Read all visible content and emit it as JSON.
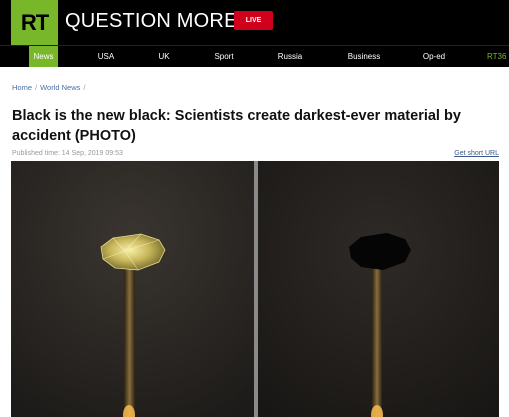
{
  "header": {
    "logo": "RT",
    "brand": "QUESTION MORE",
    "live_label": "LIVE",
    "colors": {
      "brand_green": "#78b72a",
      "live_red": "#d0021b"
    }
  },
  "nav": {
    "items": [
      {
        "label": "News",
        "active": true
      },
      {
        "label": "USA"
      },
      {
        "label": "UK"
      },
      {
        "label": "Sport"
      },
      {
        "label": "Russia"
      },
      {
        "label": "Business"
      },
      {
        "label": "Op-ed"
      },
      {
        "label": "RT36"
      }
    ]
  },
  "breadcrumb": [
    "Home",
    "World News"
  ],
  "article": {
    "title": "Black is the new black: Scientists create darkest-ever material by accident (PHOTO)",
    "published": "Published time: 14 Sep, 2019 09:53",
    "short_url_label": "Get short URL"
  },
  "image": {
    "left_panel": "golden-diamond-on-stand",
    "right_panel": "blackened-diamond-on-stand"
  }
}
